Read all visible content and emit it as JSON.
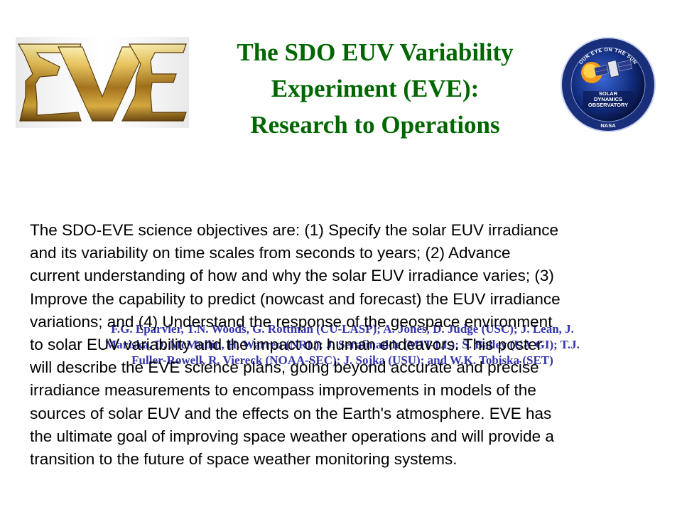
{
  "logos": {
    "eve": {
      "icon": "eve-gold-logo",
      "text": "EVE",
      "color": "#c89b2c"
    },
    "sdo": {
      "icon": "sdo-mission-patch-icon",
      "top_text": "OUR EYE ON THE SUN",
      "mission_lines": [
        "SOLAR",
        "DYNAMICS",
        "OBSERVATORY"
      ],
      "bottom_text": "NASA"
    }
  },
  "title": {
    "lines": [
      "The SDO EUV Variability",
      "Experiment (EVE):",
      "Research to Operations"
    ],
    "color": "#006600"
  },
  "authors": {
    "lines": [
      "F.G. Eparvier, T.N. Woods, G. Rottman (CU-LASP); A. Jones, D. Judge (USC); J. Lean, J.",
      "Mariska, D. McMullin, H. Warren (NRL); J. Serafinadde (MIT-LL); S. Bailey (UA-GI); T.J.",
      "Fuller-Rowell, R. Viereck (NOAA-SEC); J. Sojka (USU); and W.K. Tobiska (SET)"
    ],
    "color": "#3333aa"
  },
  "abstract": {
    "text": "The SDO-EVE science objectives are: (1) Specify the solar EUV irradiance\nand its variability on time scales from seconds to years; (2) Advance\ncurrent understanding of how and why the solar EUV irradiance varies; (3)\nImprove the capability to predict (nowcast and forecast) the EUV irradiance\nvariations; and (4) Understand the response of the geospace environment\nto solar EUV variability and the impact on human endeavors.  This poster\nwill describe the EVE science plans, going beyond accurate and precise\nirradiance measurements to encompass improvements in models of the\nsources of solar EUV and the effects on the Earth's atmosphere.  EVE has\nthe ultimate goal of improving space weather operations and will provide a\ntransition to the future of space weather monitoring systems."
  }
}
